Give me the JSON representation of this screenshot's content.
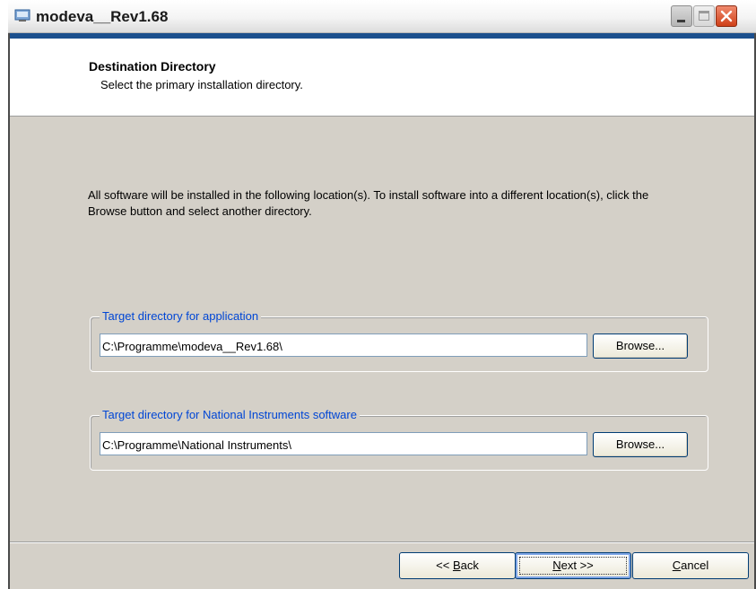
{
  "window": {
    "title": "modeva__Rev1.68"
  },
  "header": {
    "title": "Destination Directory",
    "subtitle": "Select the primary installation directory."
  },
  "main": {
    "intro": "All software will be installed in the following location(s). To install software into a different location(s), click the Browse button and select another directory.",
    "groups": [
      {
        "legend": "Target directory for application",
        "value": "C:\\Programme\\modeva__Rev1.68\\",
        "browse_label": "Browse..."
      },
      {
        "legend": "Target directory for National Instruments software",
        "value": "C:\\Programme\\National Instruments\\",
        "browse_label": "Browse..."
      }
    ]
  },
  "footer": {
    "back": {
      "prefix": "<< ",
      "key": "B",
      "rest": "ack"
    },
    "next": {
      "key": "N",
      "rest": "ext >>"
    },
    "cancel": {
      "key": "C",
      "rest": "ancel"
    }
  },
  "icons": {
    "app": "installer-icon",
    "minimize": "minimize-icon",
    "maximize": "maximize-icon",
    "close": "close-icon"
  },
  "colors": {
    "title_band": "#1b4f8d",
    "group_legend": "#0046d5",
    "close_button": "#cf4018"
  }
}
